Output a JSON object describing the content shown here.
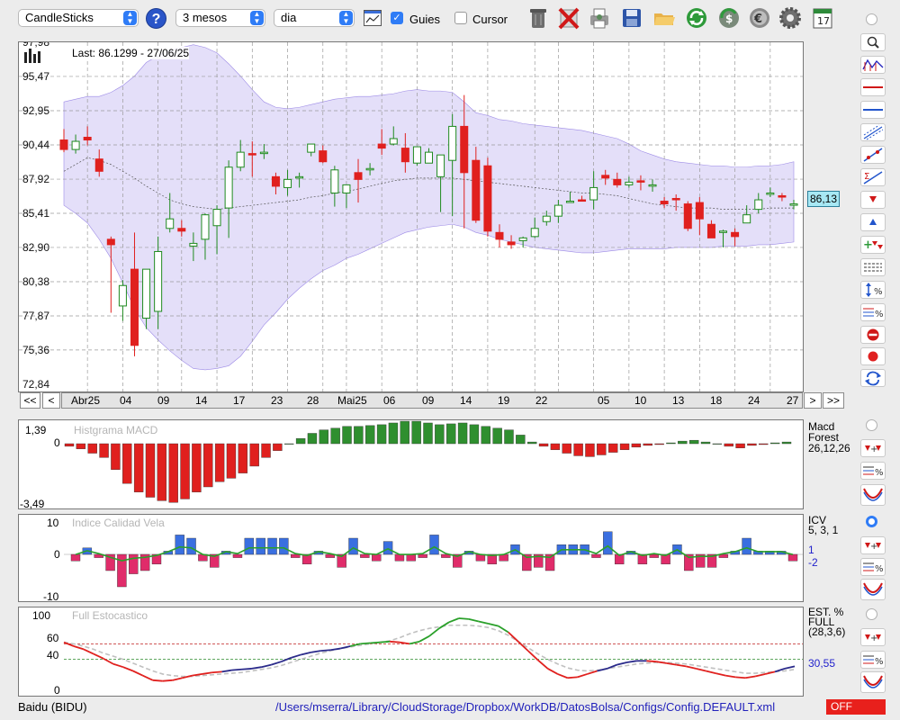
{
  "toolbar": {
    "chart_type": "CandleSticks",
    "period": "3 mesos",
    "interval": "dia",
    "guies_label": "Guies",
    "guies_checked": true,
    "cursor_label": "Cursor",
    "cursor_checked": false,
    "calendar_day": "17"
  },
  "main": {
    "last_label": "Last: 86.1299 - 27/06/25",
    "current_price": "86,13",
    "y_labels": [
      "97,98",
      "95,47",
      "92,95",
      "90,44",
      "87,92",
      "85,41",
      "82,90",
      "80,38",
      "77,87",
      "75,36",
      "72,84"
    ],
    "x_labels": [
      "Abr25",
      "04",
      "09",
      "14",
      "17",
      "23",
      "28",
      "Mai25",
      "06",
      "09",
      "14",
      "19",
      "22",
      "05",
      "10",
      "13",
      "18",
      "24",
      "27"
    ],
    "nav": {
      "first": "<<",
      "prev": "<",
      "next": ">",
      "last": ">>"
    }
  },
  "macd": {
    "title": "Histgrama MACD",
    "name": "Macd",
    "name2": "Forest",
    "params": "26,12,26",
    "y_top": "1,39",
    "y_zero": "0",
    "y_bottom": "-3,49"
  },
  "icv": {
    "title": "Indice Calidad Vela",
    "name": "ICV",
    "params": "5, 3, 1",
    "v1": "1",
    "v2": "-2",
    "y_top": "10",
    "y_zero": "0",
    "y_bottom": "-10"
  },
  "stoch": {
    "title": "Full Estocastico",
    "name": "EST. %",
    "name2": "FULL",
    "params": "(28,3,6)",
    "value": "30,55",
    "y_labels": [
      "100",
      "60",
      "40",
      "0"
    ]
  },
  "status": {
    "symbol": "Baidu (BIDU)",
    "path": "/Users/mserra/Library/CloudStorage/Dropbox/WorkDB/DatosBolsa/Configs/Config.DEFAULT.xml",
    "toggle": "OFF"
  },
  "colors": {
    "up_candle": "#1f8a1f",
    "down_candle": "#e0201e",
    "band": "#b9aaf0",
    "macd_pos": "#2f8f2f",
    "macd_neg": "#e0201e",
    "icv_pos": "#3a6fe0",
    "icv_neg": "#e02c6a",
    "stoch_k": "#e0201e",
    "stoch_d": "#c0c0c0"
  },
  "chart_data": [
    {
      "type": "candlestick",
      "title": "",
      "ylim": [
        72.84,
        97.98
      ],
      "x": [
        "01/04",
        "02/04",
        "03/04",
        "04/04",
        "07/04",
        "08/04",
        "09/04",
        "10/04",
        "11/04",
        "14/04",
        "15/04",
        "16/04",
        "17/04",
        "21/04",
        "22/04",
        "23/04",
        "24/04",
        "25/04",
        "28/04",
        "29/04",
        "30/04",
        "01/05",
        "02/05",
        "05/05",
        "06/05",
        "07/05",
        "08/05",
        "09/05",
        "12/05",
        "13/05",
        "14/05",
        "15/05",
        "16/05",
        "19/05",
        "20/05",
        "21/05",
        "22/05",
        "23/05",
        "26/05",
        "27/05",
        "28/05",
        "29/05",
        "30/05",
        "02/06",
        "03/06",
        "04/06",
        "05/06",
        "06/06",
        "09/06",
        "10/06",
        "11/06",
        "12/06",
        "13/06",
        "16/06",
        "17/06",
        "18/06",
        "19/06",
        "20/06",
        "23/06",
        "24/06",
        "25/06",
        "26/06",
        "27/06"
      ],
      "open": [
        90.8,
        90.1,
        91.0,
        89.4,
        83.5,
        78.6,
        81.3,
        77.7,
        78.2,
        84.3,
        84.3,
        83.0,
        83.5,
        84.5,
        85.8,
        88.8,
        89.8,
        89.8,
        88.1,
        87.3,
        88.0,
        89.9,
        90.0,
        86.9,
        86.9,
        88.4,
        88.6,
        90.5,
        90.5,
        90.2,
        89.1,
        89.1,
        88.1,
        89.3,
        91.8,
        89.3,
        88.9,
        84.0,
        83.3,
        83.4,
        83.7,
        84.8,
        85.2,
        86.3,
        86.4,
        86.4,
        88.2,
        87.9,
        87.5,
        87.8,
        87.5,
        86.3,
        86.5,
        86.1,
        86.2,
        84.6,
        84.0,
        84.0,
        84.7,
        85.7,
        86.8,
        86.7,
        86.0
      ],
      "high": [
        91.6,
        91.2,
        91.8,
        90.1,
        83.7,
        80.5,
        84.0,
        81.3,
        83.7,
        86.9,
        84.9,
        84.0,
        85.4,
        86.0,
        89.3,
        90.8,
        90.7,
        90.5,
        88.4,
        88.6,
        88.4,
        90.4,
        90.4,
        88.9,
        87.3,
        89.4,
        89.1,
        91.6,
        91.8,
        91.3,
        90.1,
        90.2,
        89.4,
        92.7,
        94.1,
        90.3,
        89.5,
        84.6,
        83.8,
        83.7,
        85.1,
        85.6,
        86.4,
        87.0,
        86.7,
        88.5,
        88.6,
        88.4,
        88.1,
        88.2,
        87.9,
        86.6,
        86.8,
        86.3,
        86.6,
        84.9,
        84.2,
        84.3,
        86.0,
        86.9,
        87.3,
        86.9,
        86.4
      ],
      "low": [
        89.9,
        89.8,
        90.4,
        88.1,
        78.1,
        77.5,
        74.9,
        76.9,
        76.9,
        84.0,
        83.7,
        81.9,
        82.0,
        82.4,
        83.6,
        88.5,
        88.1,
        89.4,
        86.8,
        86.7,
        87.3,
        89.6,
        89.1,
        85.9,
        85.8,
        86.2,
        88.2,
        89.7,
        90.4,
        88.4,
        88.9,
        89.1,
        85.5,
        85.2,
        84.3,
        84.7,
        83.7,
        82.9,
        82.8,
        82.9,
        83.6,
        84.5,
        84.7,
        86.2,
        86.3,
        85.7,
        87.5,
        87.3,
        87.3,
        87.1,
        87.0,
        85.8,
        85.6,
        84.1,
        83.8,
        83.6,
        82.9,
        83.0,
        84.7,
        85.4,
        86.6,
        86.3,
        85.7
      ],
      "close": [
        90.1,
        90.7,
        90.8,
        88.5,
        83.1,
        80.1,
        75.7,
        81.3,
        82.6,
        85.0,
        84.1,
        83.2,
        85.3,
        85.7,
        88.8,
        89.9,
        89.7,
        89.9,
        87.4,
        87.9,
        88.1,
        90.5,
        89.2,
        88.6,
        87.5,
        87.9,
        88.7,
        90.2,
        90.9,
        89.2,
        90.3,
        89.9,
        89.7,
        91.8,
        88.4,
        84.9,
        84.1,
        83.5,
        83.1,
        83.6,
        84.3,
        85.2,
        86.0,
        86.3,
        86.3,
        87.3,
        88.0,
        87.5,
        87.7,
        87.7,
        87.5,
        86.1,
        86.4,
        84.3,
        85.0,
        83.6,
        84.1,
        83.7,
        85.3,
        86.4,
        86.9,
        86.6,
        86.1
      ],
      "bollinger_upper": [
        93.6,
        93.8,
        94.0,
        94.0,
        94.3,
        94.8,
        95.5,
        96.5,
        97.0,
        97.4,
        97.6,
        97.8,
        97.6,
        97.2,
        96.4,
        95.5,
        94.5,
        93.6,
        93.2,
        93.1,
        93.2,
        93.4,
        93.6,
        93.8,
        93.9,
        94.0,
        94.0,
        94.1,
        94.2,
        94.4,
        94.5,
        94.4,
        94.4,
        94.3,
        93.6,
        92.8,
        92.6,
        92.3,
        92.2,
        92.0,
        91.9,
        91.8,
        91.7,
        91.6,
        91.5,
        91.3,
        91.1,
        90.9,
        90.5,
        90.0,
        89.7,
        89.4,
        89.2,
        89.1,
        89.0,
        88.9,
        88.9,
        88.8,
        88.8,
        88.9,
        88.9,
        89.0,
        89.2
      ],
      "bollinger_mid": [
        88.5,
        89.0,
        89.5,
        89.3,
        89.0,
        88.5,
        88.0,
        87.4,
        86.9,
        86.4,
        86.1,
        85.9,
        85.8,
        85.7,
        85.8,
        85.9,
        86.0,
        86.1,
        86.2,
        86.3,
        86.4,
        86.6,
        86.7,
        86.9,
        87.0,
        87.2,
        87.4,
        87.6,
        87.8,
        87.9,
        88.0,
        88.0,
        88.0,
        88.0,
        87.9,
        87.8,
        87.7,
        87.6,
        87.5,
        87.4,
        87.3,
        87.2,
        87.1,
        87.0,
        86.9,
        86.9,
        86.8,
        86.7,
        86.5,
        86.3,
        86.1,
        86.0,
        85.9,
        85.8,
        85.8,
        85.8,
        85.7,
        85.7,
        85.7,
        85.7,
        85.8,
        85.8,
        85.8
      ],
      "bollinger_lower": [
        86.0,
        85.4,
        84.7,
        83.5,
        82.1,
        80.3,
        78.4,
        77.0,
        76.1,
        75.3,
        74.6,
        74.0,
        73.9,
        74.0,
        74.2,
        74.9,
        76.0,
        77.2,
        78.1,
        79.1,
        79.9,
        80.6,
        81.2,
        81.6,
        82.1,
        82.4,
        82.8,
        83.2,
        83.6,
        84.0,
        84.2,
        84.4,
        84.5,
        84.6,
        84.4,
        84.0,
        83.8,
        83.5,
        83.3,
        83.1,
        82.9,
        82.8,
        82.7,
        82.6,
        82.5,
        82.5,
        82.6,
        82.7,
        82.8,
        82.8,
        82.8,
        82.8,
        82.9,
        82.9,
        82.9,
        82.9,
        83.0,
        83.0,
        83.0,
        83.1,
        83.1,
        83.2,
        83.3
      ]
    },
    {
      "type": "bar",
      "title": "Histgrama MACD",
      "ylim": [
        -3.49,
        1.39
      ],
      "values": [
        -0.15,
        -0.3,
        -0.55,
        -0.8,
        -1.5,
        -2.3,
        -2.8,
        -3.1,
        -3.3,
        -3.4,
        -3.2,
        -2.8,
        -2.5,
        -2.2,
        -2.0,
        -1.7,
        -1.3,
        -0.8,
        -0.4,
        0.0,
        0.3,
        0.6,
        0.8,
        0.9,
        1.0,
        1.0,
        1.05,
        1.1,
        1.2,
        1.3,
        1.3,
        1.2,
        1.1,
        1.15,
        1.2,
        1.1,
        1.0,
        0.9,
        0.8,
        0.5,
        0.1,
        -0.15,
        -0.35,
        -0.55,
        -0.7,
        -0.75,
        -0.65,
        -0.5,
        -0.35,
        -0.2,
        -0.1,
        -0.05,
        0.05,
        0.15,
        0.2,
        0.1,
        0.0,
        -0.15,
        -0.25,
        -0.1,
        -0.05,
        0.05,
        0.1
      ]
    },
    {
      "type": "bar",
      "title": "Indice Calidad Vela",
      "ylim": [
        -10,
        10
      ],
      "values": [
        -2,
        2,
        -1,
        -5,
        -10,
        -6,
        -5,
        -3,
        1,
        6,
        5,
        -2,
        -4,
        1,
        -1,
        5,
        5,
        5,
        5,
        -1,
        -3,
        1,
        -1,
        -4,
        5,
        -1,
        -2,
        4,
        -2,
        -2,
        -1,
        6,
        -1,
        -4,
        1,
        -2,
        -3,
        -2,
        3,
        -5,
        -4,
        -5,
        3,
        3,
        3,
        -1,
        7,
        -3,
        1,
        -3,
        -1,
        -3,
        3,
        -5,
        -4,
        -4,
        -1,
        1,
        5,
        1,
        1,
        1,
        -2
      ]
    },
    {
      "type": "line",
      "title": "Full Estocastico",
      "ylim": [
        0,
        100
      ],
      "series": [
        {
          "values": [
            62,
            57,
            53,
            47,
            41,
            34,
            30,
            25,
            19,
            13,
            12,
            13,
            16,
            19,
            21,
            23,
            24,
            26,
            27,
            28,
            30,
            33,
            37,
            42,
            46,
            49,
            51,
            52,
            54,
            57,
            60,
            61,
            62,
            63,
            62,
            60,
            63,
            70,
            80,
            88,
            93,
            92,
            89,
            86,
            83,
            75,
            63,
            51,
            39,
            28,
            21,
            16,
            17,
            21,
            25,
            28,
            33,
            36,
            38,
            38,
            37,
            35,
            33,
            31,
            28,
            25,
            22,
            19,
            17,
            16,
            18,
            21,
            24,
            28,
            31
          ]
        },
        {
          "values": [
            62,
            60,
            57,
            53,
            48,
            44,
            40,
            35,
            30,
            25,
            21,
            19,
            18,
            18,
            19,
            20,
            21,
            22,
            23,
            25,
            27,
            29,
            32,
            36,
            40,
            44,
            48,
            51,
            54,
            56,
            58,
            60,
            62,
            64,
            68,
            73,
            77,
            80,
            82,
            84,
            84,
            84,
            83,
            81,
            77,
            71,
            63,
            55,
            47,
            40,
            34,
            29,
            26,
            25,
            26,
            28,
            30,
            32,
            34,
            35,
            36,
            36,
            35,
            34,
            32,
            30,
            28,
            26,
            24,
            22,
            22,
            23,
            24,
            25,
            27
          ]
        }
      ]
    }
  ]
}
